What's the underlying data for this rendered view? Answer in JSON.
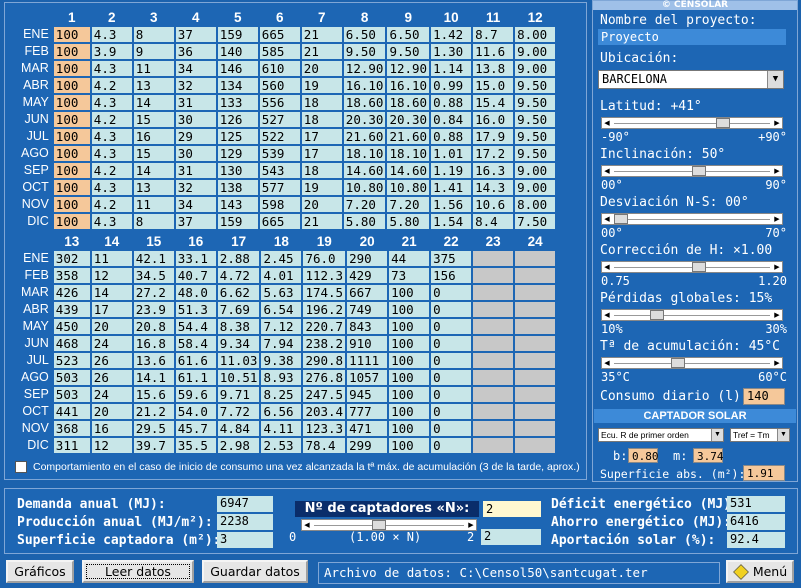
{
  "months": [
    "ENE",
    "FEB",
    "MAR",
    "ABR",
    "MAY",
    "JUN",
    "JUL",
    "AGO",
    "SEP",
    "OCT",
    "NOV",
    "DIC"
  ],
  "top_columns": [
    "1",
    "2",
    "3",
    "4",
    "5",
    "6",
    "7",
    "8",
    "9",
    "10",
    "11",
    "12"
  ],
  "top_rows": [
    [
      "100",
      "4.3",
      "8",
      "37",
      "159",
      "665",
      "21",
      "6.50",
      "6.50",
      "1.42",
      "8.7",
      "8.00"
    ],
    [
      "100",
      "3.9",
      "9",
      "36",
      "140",
      "585",
      "21",
      "9.50",
      "9.50",
      "1.30",
      "11.6",
      "9.00"
    ],
    [
      "100",
      "4.3",
      "11",
      "34",
      "146",
      "610",
      "20",
      "12.90",
      "12.90",
      "1.14",
      "13.8",
      "9.00"
    ],
    [
      "100",
      "4.2",
      "13",
      "32",
      "134",
      "560",
      "19",
      "16.10",
      "16.10",
      "0.99",
      "15.0",
      "9.50"
    ],
    [
      "100",
      "4.3",
      "14",
      "31",
      "133",
      "556",
      "18",
      "18.60",
      "18.60",
      "0.88",
      "15.4",
      "9.50"
    ],
    [
      "100",
      "4.2",
      "15",
      "30",
      "126",
      "527",
      "18",
      "20.30",
      "20.30",
      "0.84",
      "16.0",
      "9.50"
    ],
    [
      "100",
      "4.3",
      "16",
      "29",
      "125",
      "522",
      "17",
      "21.60",
      "21.60",
      "0.88",
      "17.9",
      "9.50"
    ],
    [
      "100",
      "4.3",
      "15",
      "30",
      "129",
      "539",
      "17",
      "18.10",
      "18.10",
      "1.01",
      "17.2",
      "9.50"
    ],
    [
      "100",
      "4.2",
      "14",
      "31",
      "130",
      "543",
      "18",
      "14.60",
      "14.60",
      "1.19",
      "16.3",
      "9.00"
    ],
    [
      "100",
      "4.3",
      "13",
      "32",
      "138",
      "577",
      "19",
      "10.80",
      "10.80",
      "1.41",
      "14.3",
      "9.00"
    ],
    [
      "100",
      "4.2",
      "11",
      "34",
      "143",
      "598",
      "20",
      "7.20",
      "7.20",
      "1.56",
      "10.6",
      "8.00"
    ],
    [
      "100",
      "4.3",
      "8",
      "37",
      "159",
      "665",
      "21",
      "5.80",
      "5.80",
      "1.54",
      "8.4",
      "7.50"
    ]
  ],
  "bottom_columns": [
    "13",
    "14",
    "15",
    "16",
    "17",
    "18",
    "19",
    "20",
    "21",
    "22",
    "23",
    "24"
  ],
  "bottom_rows": [
    [
      "302",
      "11",
      "42.1",
      "33.1",
      "2.88",
      "2.45",
      "76.0",
      "290",
      "44",
      "375",
      "",
      ""
    ],
    [
      "358",
      "12",
      "34.5",
      "40.7",
      "4.72",
      "4.01",
      "112.3",
      "429",
      "73",
      "156",
      "",
      ""
    ],
    [
      "426",
      "14",
      "27.2",
      "48.0",
      "6.62",
      "5.63",
      "174.5",
      "667",
      "100",
      "0",
      "",
      ""
    ],
    [
      "439",
      "17",
      "23.9",
      "51.3",
      "7.69",
      "6.54",
      "196.2",
      "749",
      "100",
      "0",
      "",
      ""
    ],
    [
      "450",
      "20",
      "20.8",
      "54.4",
      "8.38",
      "7.12",
      "220.7",
      "843",
      "100",
      "0",
      "",
      ""
    ],
    [
      "468",
      "24",
      "16.8",
      "58.4",
      "9.34",
      "7.94",
      "238.2",
      "910",
      "100",
      "0",
      "",
      ""
    ],
    [
      "523",
      "26",
      "13.6",
      "61.6",
      "11.03",
      "9.38",
      "290.8",
      "1111",
      "100",
      "0",
      "",
      ""
    ],
    [
      "503",
      "26",
      "14.1",
      "61.1",
      "10.51",
      "8.93",
      "276.8",
      "1057",
      "100",
      "0",
      "",
      ""
    ],
    [
      "503",
      "24",
      "15.6",
      "59.6",
      "9.71",
      "8.25",
      "247.5",
      "945",
      "100",
      "0",
      "",
      ""
    ],
    [
      "441",
      "20",
      "21.2",
      "54.0",
      "7.72",
      "6.56",
      "203.4",
      "777",
      "100",
      "0",
      "",
      ""
    ],
    [
      "368",
      "16",
      "29.5",
      "45.7",
      "4.84",
      "4.11",
      "123.3",
      "471",
      "100",
      "0",
      "",
      ""
    ],
    [
      "311",
      "12",
      "39.7",
      "35.5",
      "2.98",
      "2.53",
      "78.4",
      "299",
      "100",
      "0",
      "",
      ""
    ]
  ],
  "behavior_label": "Comportamiento en el caso de inicio de consumo una vez alcanzada la tª máx. de acumulación (3 de la tarde, aprox.)",
  "right": {
    "brand": "© CENSOLAR",
    "project_label": "Nombre del proyecto:",
    "project_value": "Proyecto",
    "location_label": "Ubicación:",
    "location_value": "BARCELONA",
    "latitude_label": "Latitud: +41°",
    "latitude_min": "-90°",
    "latitude_max": "+90°",
    "latitude_level": 0.72,
    "inclination_label": "Inclinación: 50°",
    "inclination_min": "00°",
    "inclination_max": "90°",
    "inclination_level": 0.55,
    "deviation_label": "Desviación N-S: 00°",
    "deviation_min": "00°",
    "deviation_max": "70°",
    "deviation_level": 0.0,
    "correction_label": "Corrección de H: ×1.00",
    "correction_min": "0.75",
    "correction_max": "1.20",
    "correction_level": 0.55,
    "losses_label": "Pérdidas globales: 15%",
    "losses_min": "10%",
    "losses_max": "30%",
    "losses_level": 0.25,
    "accum_label": "Tª de acumulación: 45°C",
    "accum_min": "35°C",
    "accum_max": "60°C",
    "accum_level": 0.4,
    "consumption_label": "Consumo diario (l):",
    "consumption_value": "140",
    "collector_header": "CAPTADOR SOLAR",
    "collector_select1": "Ecu. R de primer orden",
    "collector_select2": "Tref = Tm",
    "b_label": "b:",
    "b_value": "0.80",
    "m_label": "m:",
    "m_value": "3.74",
    "surface_label": "Superficie abs. (m²):",
    "surface_value": "1.91"
  },
  "bottom": {
    "demand_label": "Demanda anual (MJ):",
    "demand_value": "6947",
    "production_label": "Producción anual (MJ/m²):",
    "production_value": "2238",
    "collector_surface_label": "Superficie captadora (m²):",
    "collector_surface_value": "3",
    "n_header": "Nº de captadores «N»:",
    "n_value": "2",
    "n_min": "0",
    "n_max": "2",
    "n_scale": "(1.00 × N)",
    "n_slider_value": "2",
    "deficit_label": "Déficit energético (MJ):",
    "deficit_value": "531",
    "savings_label": "Ahorro energético (MJ):",
    "savings_value": "6416",
    "solar_label": "Aportación solar (%):",
    "solar_value": "92.4"
  },
  "footer": {
    "graphs_button": "Gráficos",
    "read_button": "Leer datos",
    "save_button": "Guardar datos",
    "status": "Archivo de datos: C:\\Censol50\\santcugat.ter",
    "menu_button": "Menú"
  }
}
